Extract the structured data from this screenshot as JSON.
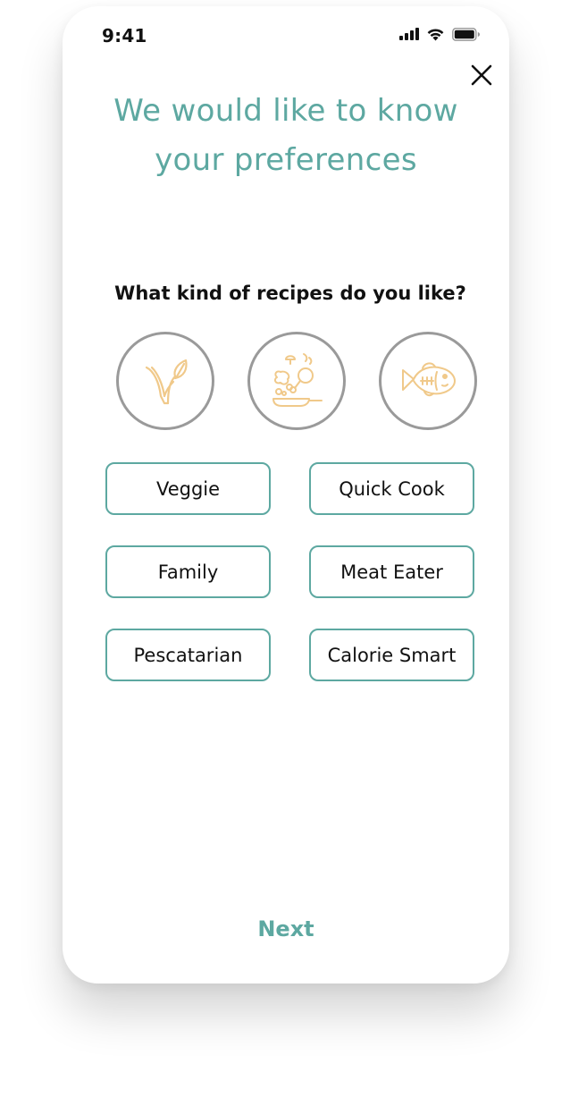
{
  "status_bar": {
    "time": "9:41"
  },
  "header": {
    "title_line1": "We would like to know",
    "title_line2": "your preferences",
    "close_icon": "close-icon"
  },
  "question": "What kind of recipes do you like?",
  "category_icons": [
    {
      "name": "veggie-leaf-icon"
    },
    {
      "name": "cooking-pan-icon"
    },
    {
      "name": "fish-icon"
    }
  ],
  "preferences": [
    {
      "label": "Veggie"
    },
    {
      "label": "Quick Cook"
    },
    {
      "label": "Family"
    },
    {
      "label": "Meat Eater"
    },
    {
      "label": "Pescatarian"
    },
    {
      "label": "Calorie Smart"
    }
  ],
  "footer": {
    "next_label": "Next"
  },
  "colors": {
    "accent": "#5da8a1",
    "icon_line": "#f0c98a",
    "circle_border": "#9a9a9a",
    "text": "#111111"
  }
}
